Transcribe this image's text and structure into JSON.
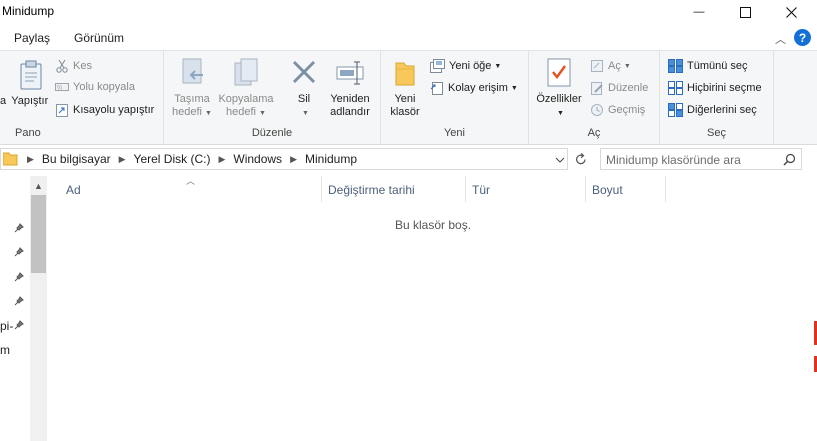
{
  "window": {
    "title": "Minidump",
    "minimize_glyph": "—",
    "maximize_glyph": "☐",
    "close_glyph": "✕"
  },
  "menu_tabs": {
    "share": "Paylaş",
    "view": "Görünüm",
    "help": "?"
  },
  "ribbon": {
    "pano": {
      "label": "Pano",
      "paste": "Yapıştır",
      "paste_partial": "a",
      "cut": "Kes",
      "copy_path": "Yolu kopyala",
      "paste_shortcut": "Kısayolu yapıştır"
    },
    "duzenle": {
      "label": "Düzenle",
      "move_to_1": "Taşıma",
      "move_to_2": "hedefi",
      "copy_to_1": "Kopyalama",
      "copy_to_2": "hedefi",
      "delete": "Sil",
      "rename_1": "Yeniden",
      "rename_2": "adlandır"
    },
    "yeni": {
      "label": "Yeni",
      "new_folder_1": "Yeni",
      "new_folder_2": "klasör",
      "new_item": "Yeni öğe",
      "easy_access": "Kolay erişim"
    },
    "ac": {
      "label": "Aç",
      "properties": "Özellikler",
      "open": "Aç",
      "edit": "Düzenle",
      "history": "Geçmiş"
    },
    "sec": {
      "label": "Seç",
      "select_all": "Tümünü seç",
      "select_none": "Hiçbirini seçme",
      "invert": "Diğerlerini seç"
    }
  },
  "address": {
    "breadcrumb": [
      "Bu bilgisayar",
      "Yerel Disk (C:)",
      "Windows",
      "Minidump"
    ],
    "search_placeholder": "Minidump klasöründe ara"
  },
  "nav_pane": {
    "item_partial_1": "pi-",
    "item_partial_2": "m"
  },
  "columns": {
    "name": "Ad",
    "modified": "Değiştirme tarihi",
    "type": "Tür",
    "size": "Boyut"
  },
  "empty_message": "Bu klasör boş.",
  "colors": {
    "accent_blue": "#1470d6",
    "column_header_text": "#4c607a",
    "folder_yellow": "#f8c95a"
  }
}
